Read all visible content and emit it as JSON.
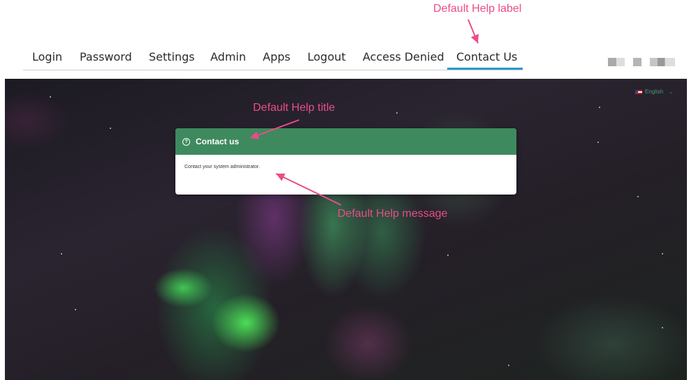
{
  "nav": {
    "tabs": [
      {
        "label": "Login"
      },
      {
        "label": "Password"
      },
      {
        "label": "Settings"
      },
      {
        "label": "Admin"
      },
      {
        "label": "Apps"
      },
      {
        "label": "Logout"
      },
      {
        "label": "Access Denied"
      },
      {
        "label": "Contact Us",
        "active": true
      }
    ]
  },
  "language": {
    "label": "English"
  },
  "help": {
    "title": "Contact us",
    "message": "Contact your system administrator."
  },
  "annotations": {
    "label": "Default Help label",
    "title": "Default Help title",
    "message": "Default Help message"
  },
  "colors": {
    "header_green": "#3e8a5e",
    "tab_underline": "#2a9bc6",
    "annotation_pink": "#ea4c89"
  }
}
